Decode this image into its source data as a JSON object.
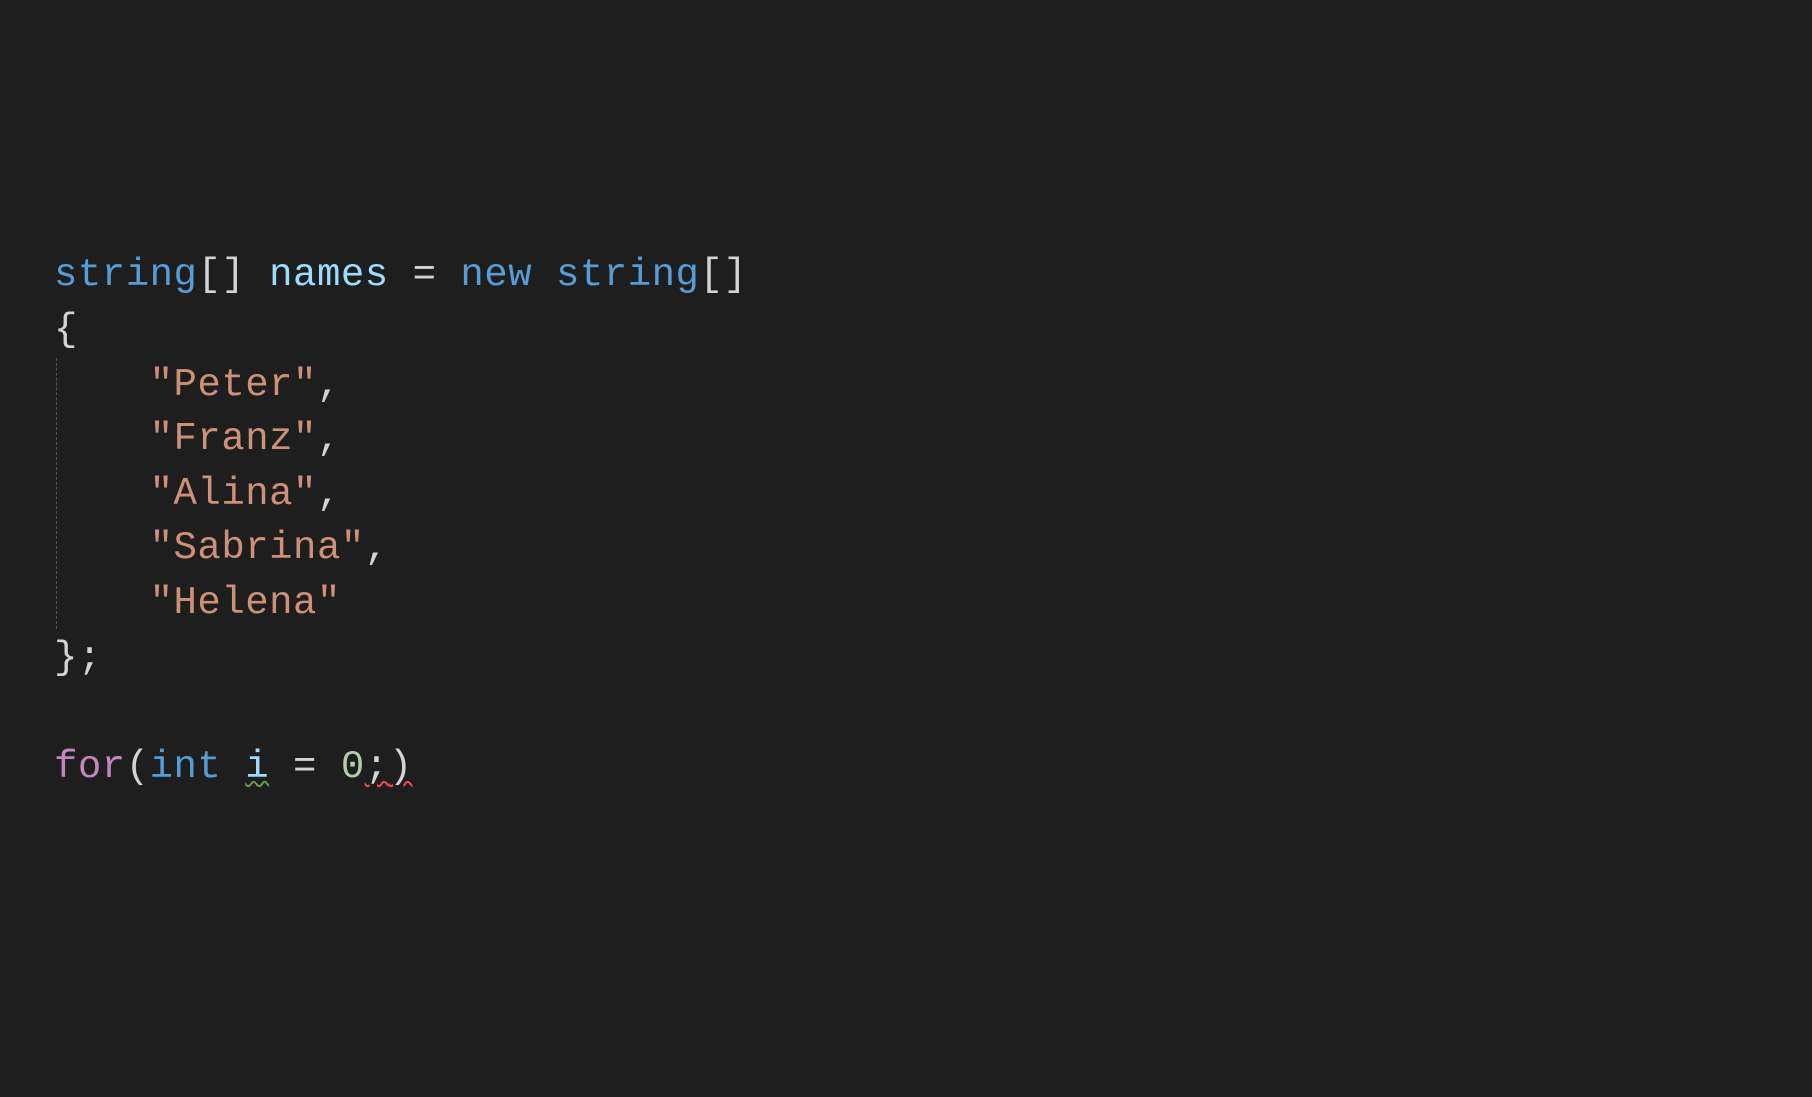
{
  "code": {
    "line1": {
      "type1": "string",
      "brackets1": "[]",
      "space1": " ",
      "var": "names",
      "op": " = ",
      "new": "new",
      "space2": " ",
      "type2": "string",
      "brackets2": "[]"
    },
    "line2": {
      "brace": "{"
    },
    "strings": {
      "s1": "\"Peter\"",
      "c1": ",",
      "s2": "\"Franz\"",
      "c2": ",",
      "s3": "\"Alina\"",
      "c3": ",",
      "s4": "\"Sabrina\"",
      "c4": ",",
      "s5": "\"Helena\""
    },
    "line8": {
      "close": "};"
    },
    "line10": {
      "for": "for",
      "paren1": "(",
      "int": "int",
      "space": " ",
      "i": "i",
      "eq": " = ",
      "zero": "0",
      "semi": ";",
      "paren2": ")"
    }
  }
}
